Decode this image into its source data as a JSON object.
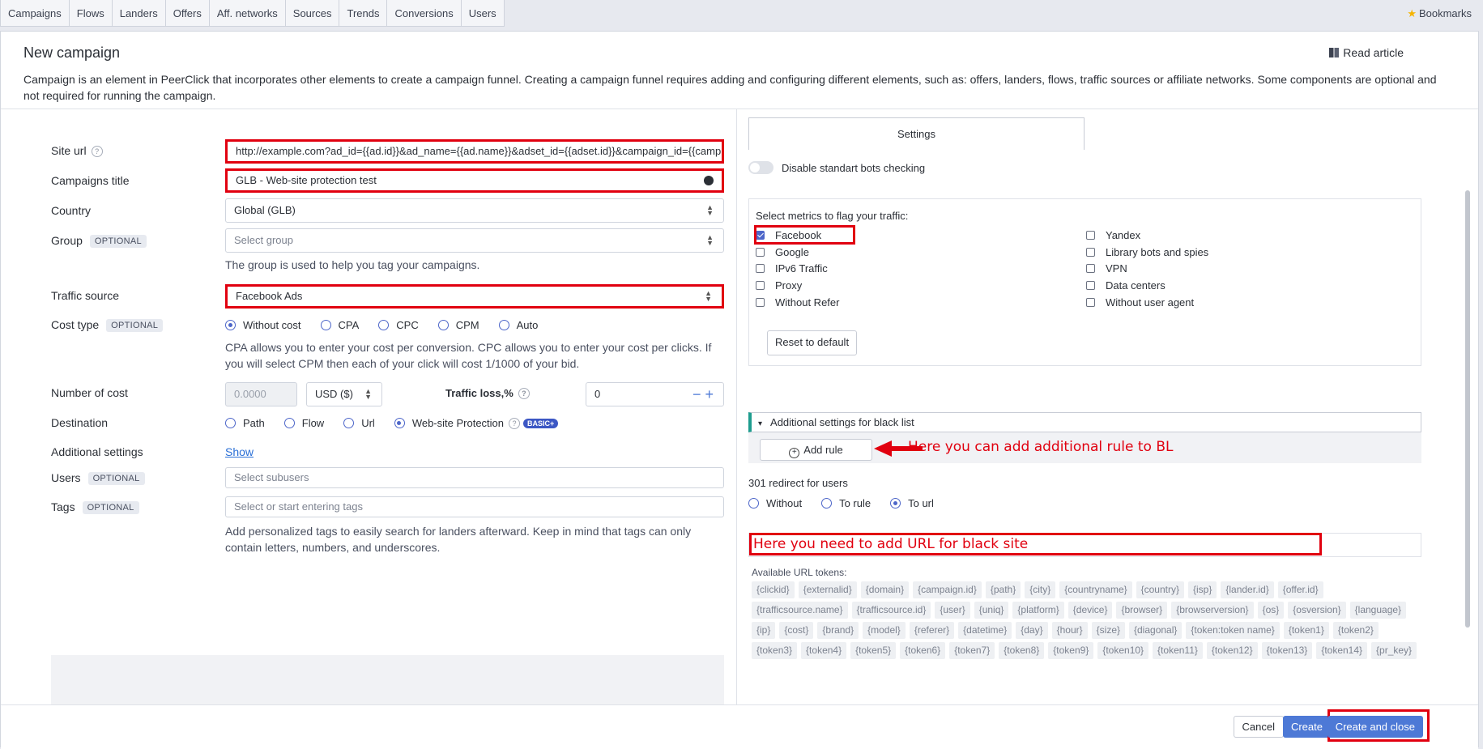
{
  "nav": {
    "tabs": [
      "Campaigns",
      "Flows",
      "Landers",
      "Offers",
      "Aff. networks",
      "Sources",
      "Trends",
      "Conversions",
      "Users"
    ],
    "bookmarks": "Bookmarks"
  },
  "header": {
    "title": "New campaign",
    "read_article": "Read article",
    "description": "Campaign is an element in PeerClick that incorporates other elements to create a campaign funnel. Creating a campaign funnel requires adding and configuring different elements, such as: offers, landers, flows, traffic sources or affiliate networks. Some components are optional and not required for running the campaign."
  },
  "form": {
    "optional_badge": "OPTIONAL",
    "site_url": {
      "label": "Site url",
      "value": "http://example.com?ad_id={{ad.id}}&ad_name={{ad.name}}&adset_id={{adset.id}}&campaign_id={{camp"
    },
    "title": {
      "label": "Campaigns title",
      "value": "GLB - Web-site protection test"
    },
    "country": {
      "label": "Country",
      "value": "Global (GLB)"
    },
    "group": {
      "label": "Group",
      "placeholder": "Select group",
      "hint": "The group is used to help you tag your campaigns."
    },
    "traffic_source": {
      "label": "Traffic source",
      "value": "Facebook Ads"
    },
    "cost_type": {
      "label": "Cost type",
      "options": [
        "Without cost",
        "CPA",
        "CPC",
        "CPM",
        "Auto"
      ],
      "selected": "Without cost",
      "hint": "CPA allows you to enter your cost per conversion. CPC allows you to enter your cost per clicks. If you will select CPM then each of your click will cost 1/1000 of your bid."
    },
    "number_of_cost": {
      "label": "Number of cost",
      "placeholder": "0.0000",
      "currency": "USD ($)",
      "traffic_loss_label": "Traffic loss,%",
      "traffic_loss_value": "0"
    },
    "destination": {
      "label": "Destination",
      "options": [
        "Path",
        "Flow",
        "Url",
        "Web-site Protection"
      ],
      "selected": "Web-site Protection",
      "badge": "BASIC+"
    },
    "additional_settings": {
      "label": "Additional settings",
      "link": "Show"
    },
    "users": {
      "label": "Users",
      "placeholder": "Select subusers"
    },
    "tags": {
      "label": "Tags",
      "placeholder": "Select or start entering tags",
      "hint": "Add personalized tags to easily search for landers afterward. Keep in mind that tags can only contain letters, numbers, and underscores."
    }
  },
  "settings": {
    "tab": "Settings",
    "toggle_label": "Disable standart bots checking",
    "metrics_title": "Select metrics to flag your traffic:",
    "metrics_left": [
      {
        "label": "Facebook",
        "checked": true
      },
      {
        "label": "Google",
        "checked": false
      },
      {
        "label": "IPv6 Traffic",
        "checked": false
      },
      {
        "label": "Proxy",
        "checked": false
      },
      {
        "label": "Without Refer",
        "checked": false
      }
    ],
    "metrics_right": [
      {
        "label": "Yandex",
        "checked": false
      },
      {
        "label": "Library bots and spies",
        "checked": false
      },
      {
        "label": "VPN",
        "checked": false
      },
      {
        "label": "Data centers",
        "checked": false
      },
      {
        "label": "Without user agent",
        "checked": false
      }
    ],
    "reset_button": "Reset to default",
    "blacklist_header": "Additional settings for black list",
    "add_rule": "Add rule",
    "annotation_rule": "Here you can add additional rule to BL",
    "redirect_label": "301 redirect for users",
    "redirect_options": [
      "Without",
      "To rule",
      "To url"
    ],
    "redirect_selected": "To url",
    "annotation_url": "Here you need to add URL for black site",
    "tokens_label": "Available URL tokens:",
    "tokens": [
      "{clickid}",
      "{externalid}",
      "{domain}",
      "{campaign.id}",
      "{path}",
      "{city}",
      "{countryname}",
      "{country}",
      "{isp}",
      "{lander.id}",
      "{offer.id}",
      "{trafficsource.name}",
      "{trafficsource.id}",
      "{user}",
      "{uniq}",
      "{platform}",
      "{device}",
      "{browser}",
      "{browserversion}",
      "{os}",
      "{osversion}",
      "{language}",
      "{ip}",
      "{cost}",
      "{brand}",
      "{model}",
      "{referer}",
      "{datetime}",
      "{day}",
      "{hour}",
      "{size}",
      "{diagonal}",
      "{token:token name}",
      "{token1}",
      "{token2}",
      "{token3}",
      "{token4}",
      "{token5}",
      "{token6}",
      "{token7}",
      "{token8}",
      "{token9}",
      "{token10}",
      "{token11}",
      "{token12}",
      "{token13}",
      "{token14}",
      "{pr_key}"
    ]
  },
  "footer": {
    "cancel": "Cancel",
    "create": "Create",
    "create_close": "Create and close"
  },
  "colors": {
    "accent": "#4d79d6",
    "annotation_red": "#e1000f",
    "teal": "#1e9d8f"
  }
}
